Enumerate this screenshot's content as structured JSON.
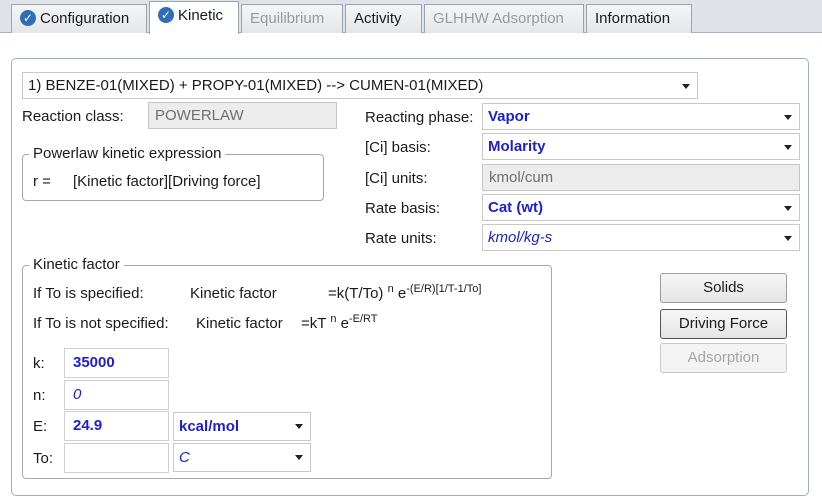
{
  "tabs": [
    {
      "label": "Configuration",
      "checked": true,
      "state": "normal"
    },
    {
      "label": "Kinetic",
      "checked": true,
      "state": "active"
    },
    {
      "label": "Equilibrium",
      "checked": false,
      "state": "disabled"
    },
    {
      "label": "Activity",
      "checked": false,
      "state": "normal"
    },
    {
      "label": "GLHHW Adsorption",
      "checked": false,
      "state": "disabled"
    },
    {
      "label": "Information",
      "checked": false,
      "state": "normal"
    }
  ],
  "reaction_select": {
    "value": "1) BENZE-01(MIXED)  + PROPY-01(MIXED)  -->  CUMEN-01(MIXED)"
  },
  "reaction_class": {
    "label": "Reaction class:",
    "value": "POWERLAW"
  },
  "powerlaw_group": {
    "title": "Powerlaw kinetic expression",
    "lhs": "r =",
    "rhs": "[Kinetic factor][Driving force]"
  },
  "reacting_phase": {
    "label": "Reacting phase:",
    "value": "Vapor"
  },
  "ci_basis": {
    "label": "[Ci] basis:",
    "value": "Molarity"
  },
  "ci_units": {
    "label": "[Ci] units:",
    "value": "kmol/cum"
  },
  "rate_basis": {
    "label": "Rate basis:",
    "value": "Cat (wt)"
  },
  "rate_units": {
    "label": "Rate units:",
    "value": "kmol/kg-s"
  },
  "kinetic_group": {
    "title": "Kinetic factor",
    "line1_condition": "If To is specified:",
    "line1_name": "Kinetic factor",
    "line1_base": "=k(T/To)",
    "line1_n": "n",
    "line1_e": "e",
    "line1_exp": "-(E/R)[1/T-1/To]",
    "line2_condition": "If To is not specified:",
    "line2_name": "Kinetic factor",
    "line2_base": "=kT",
    "line2_n": "n",
    "line2_e": "e",
    "line2_exp": "-E/RT"
  },
  "params": {
    "k": {
      "label": "k:",
      "value": "35000"
    },
    "n": {
      "label": "n:",
      "value": "0"
    },
    "E": {
      "label": "E:",
      "value": "24.9",
      "unit": "kcal/mol"
    },
    "To": {
      "label": "To:",
      "value": "",
      "unit": "C"
    }
  },
  "buttons": {
    "solids": "Solids",
    "driving_force": "Driving Force",
    "adsorption": "Adsorption"
  },
  "colors": {
    "accent_blue": "#1b1fd6",
    "tab_check": "#2f6fb5"
  }
}
